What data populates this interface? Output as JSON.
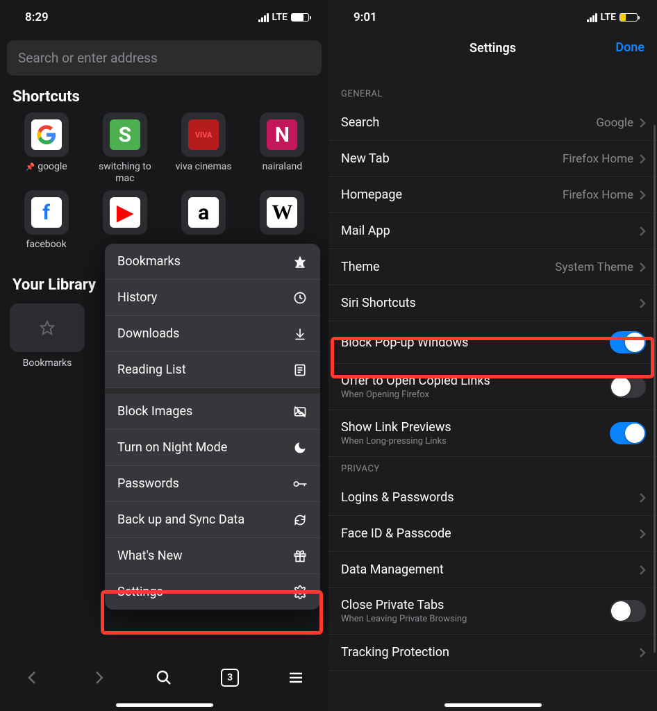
{
  "left": {
    "status": {
      "time": "8:29",
      "network": "LTE"
    },
    "search_placeholder": "Search or enter address",
    "shortcuts_title": "Shortcuts",
    "shortcuts": [
      {
        "label": "google",
        "pinned": true,
        "bg": "#ffffff",
        "glyph": "G",
        "glyph_color": ""
      },
      {
        "label": "switching to mac",
        "pinned": false,
        "bg": "#4caf50",
        "glyph": "S",
        "glyph_color": "#ffffff"
      },
      {
        "label": "viva cinemas",
        "pinned": false,
        "bg": "#b71c1c",
        "glyph": "VIVA",
        "glyph_color": "#ff5252"
      },
      {
        "label": "nairaland",
        "pinned": false,
        "bg": "#c2185b",
        "glyph": "N",
        "glyph_color": "#ffffff"
      },
      {
        "label": "facebook",
        "pinned": false,
        "bg": "#ffffff",
        "glyph": "f",
        "glyph_color": "#1877f2"
      },
      {
        "label": "",
        "pinned": false,
        "bg": "#ffffff",
        "glyph": "▶",
        "glyph_color": "#ff0000"
      },
      {
        "label": "",
        "pinned": false,
        "bg": "#ffffff",
        "glyph": "a",
        "glyph_color": "#000000"
      },
      {
        "label": "",
        "pinned": false,
        "bg": "#ffffff",
        "glyph": "W",
        "glyph_color": "#000000"
      }
    ],
    "library_title": "Your Library",
    "library": [
      {
        "label": "Bookmarks"
      }
    ],
    "menu": [
      {
        "label": "Bookmarks",
        "icon": "star-filled"
      },
      {
        "label": "History",
        "icon": "clock"
      },
      {
        "label": "Downloads",
        "icon": "download"
      },
      {
        "label": "Reading List",
        "icon": "reader"
      },
      {
        "divider": true
      },
      {
        "label": "Block Images",
        "icon": "no-image"
      },
      {
        "label": "Turn on Night Mode",
        "icon": "moon"
      },
      {
        "label": "Passwords",
        "icon": "key"
      },
      {
        "label": "Back up and Sync Data",
        "icon": "sync"
      },
      {
        "label": "What's New",
        "icon": "gift"
      },
      {
        "label": "Settings",
        "icon": "gear"
      }
    ],
    "tab_count": "3"
  },
  "right": {
    "status": {
      "time": "9:01",
      "network": "LTE"
    },
    "title": "Settings",
    "done": "Done",
    "groups": [
      {
        "header": "GENERAL",
        "rows": [
          {
            "label": "Search",
            "value": "Google",
            "type": "nav"
          },
          {
            "label": "New Tab",
            "value": "Firefox Home",
            "type": "nav"
          },
          {
            "label": "Homepage",
            "value": "Firefox Home",
            "type": "nav"
          },
          {
            "label": "Mail App",
            "value": "",
            "type": "nav"
          },
          {
            "label": "Theme",
            "value": "System Theme",
            "type": "nav"
          },
          {
            "label": "Siri Shortcuts",
            "value": "",
            "type": "nav"
          },
          {
            "label": "Block Pop-up Windows",
            "type": "toggle",
            "on": true
          },
          {
            "label": "Offer to Open Copied Links",
            "sub": "When Opening Firefox",
            "type": "toggle",
            "on": false
          },
          {
            "label": "Show Link Previews",
            "sub": "When Long-pressing Links",
            "type": "toggle",
            "on": true
          }
        ]
      },
      {
        "header": "PRIVACY",
        "rows": [
          {
            "label": "Logins & Passwords",
            "type": "nav"
          },
          {
            "label": "Face ID & Passcode",
            "type": "nav"
          },
          {
            "label": "Data Management",
            "type": "nav"
          },
          {
            "label": "Close Private Tabs",
            "sub": "When Leaving Private Browsing",
            "type": "toggle",
            "on": false
          },
          {
            "label": "Tracking Protection",
            "type": "nav"
          }
        ]
      }
    ]
  }
}
